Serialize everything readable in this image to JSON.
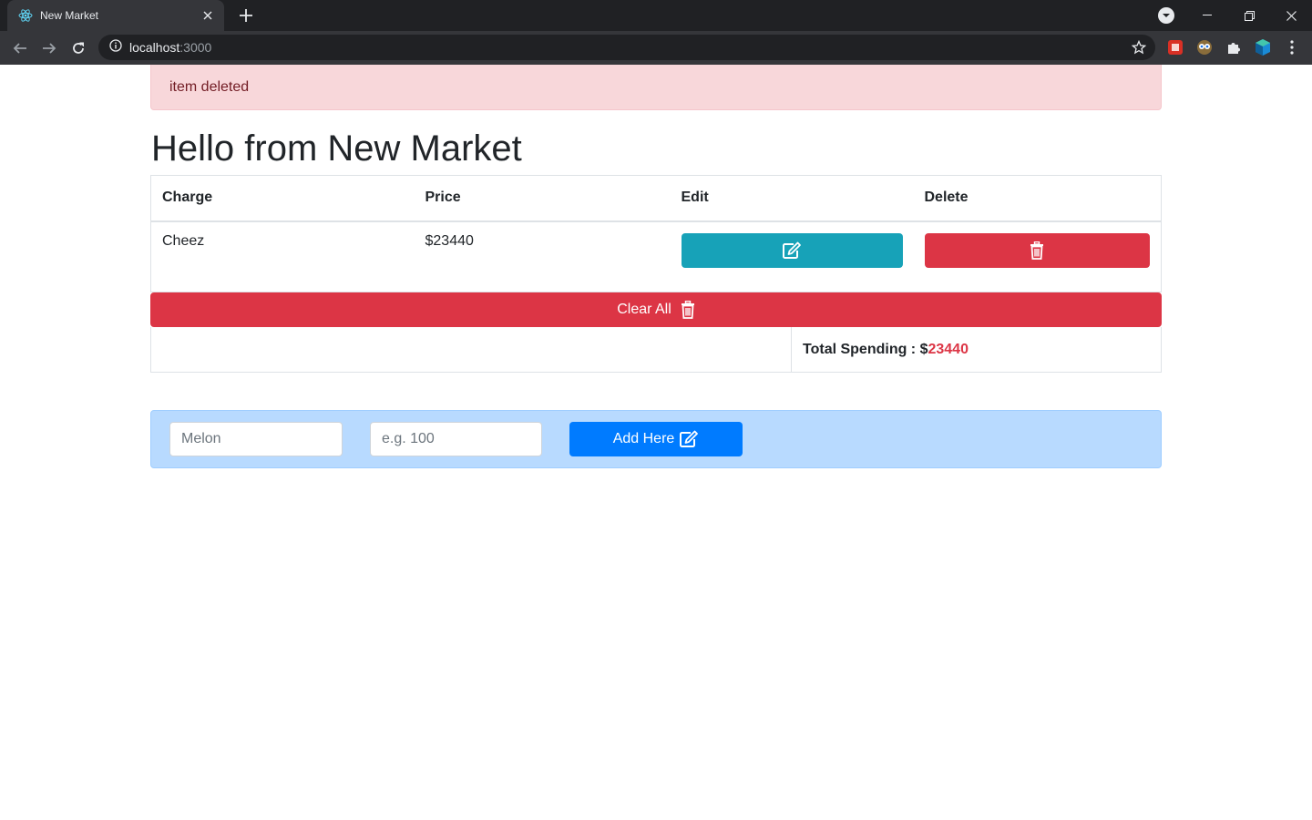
{
  "browser": {
    "tab_title": "New Market",
    "url_host": "localhost",
    "url_port": ":3000",
    "icons": [
      "react-favicon-icon",
      "close-icon",
      "plus-icon",
      "back-icon",
      "forward-icon",
      "reload-icon",
      "info-icon",
      "star-icon",
      "puzzle-icon"
    ]
  },
  "alert": {
    "message": "item deleted",
    "color": "#f8d7da"
  },
  "page": {
    "title": "Hello from New Market"
  },
  "table": {
    "headers": [
      "Charge",
      "Price",
      "Edit",
      "Delete"
    ],
    "rows": [
      {
        "charge": "Cheez",
        "price": "$23440"
      }
    ]
  },
  "clear_all": {
    "label": "Clear All",
    "icon": "trash-icon"
  },
  "total": {
    "label": "Total Spending : $",
    "value": "23440"
  },
  "form": {
    "charge_placeholder": "Melon",
    "amount_placeholder": "e.g. 100",
    "submit_label": "Add Here",
    "submit_icon": "edit-icon"
  },
  "colors": {
    "edit_button": "#17a2b8",
    "delete_button": "#dc3545",
    "add_button": "#007bff",
    "form_background": "#b8daff"
  }
}
